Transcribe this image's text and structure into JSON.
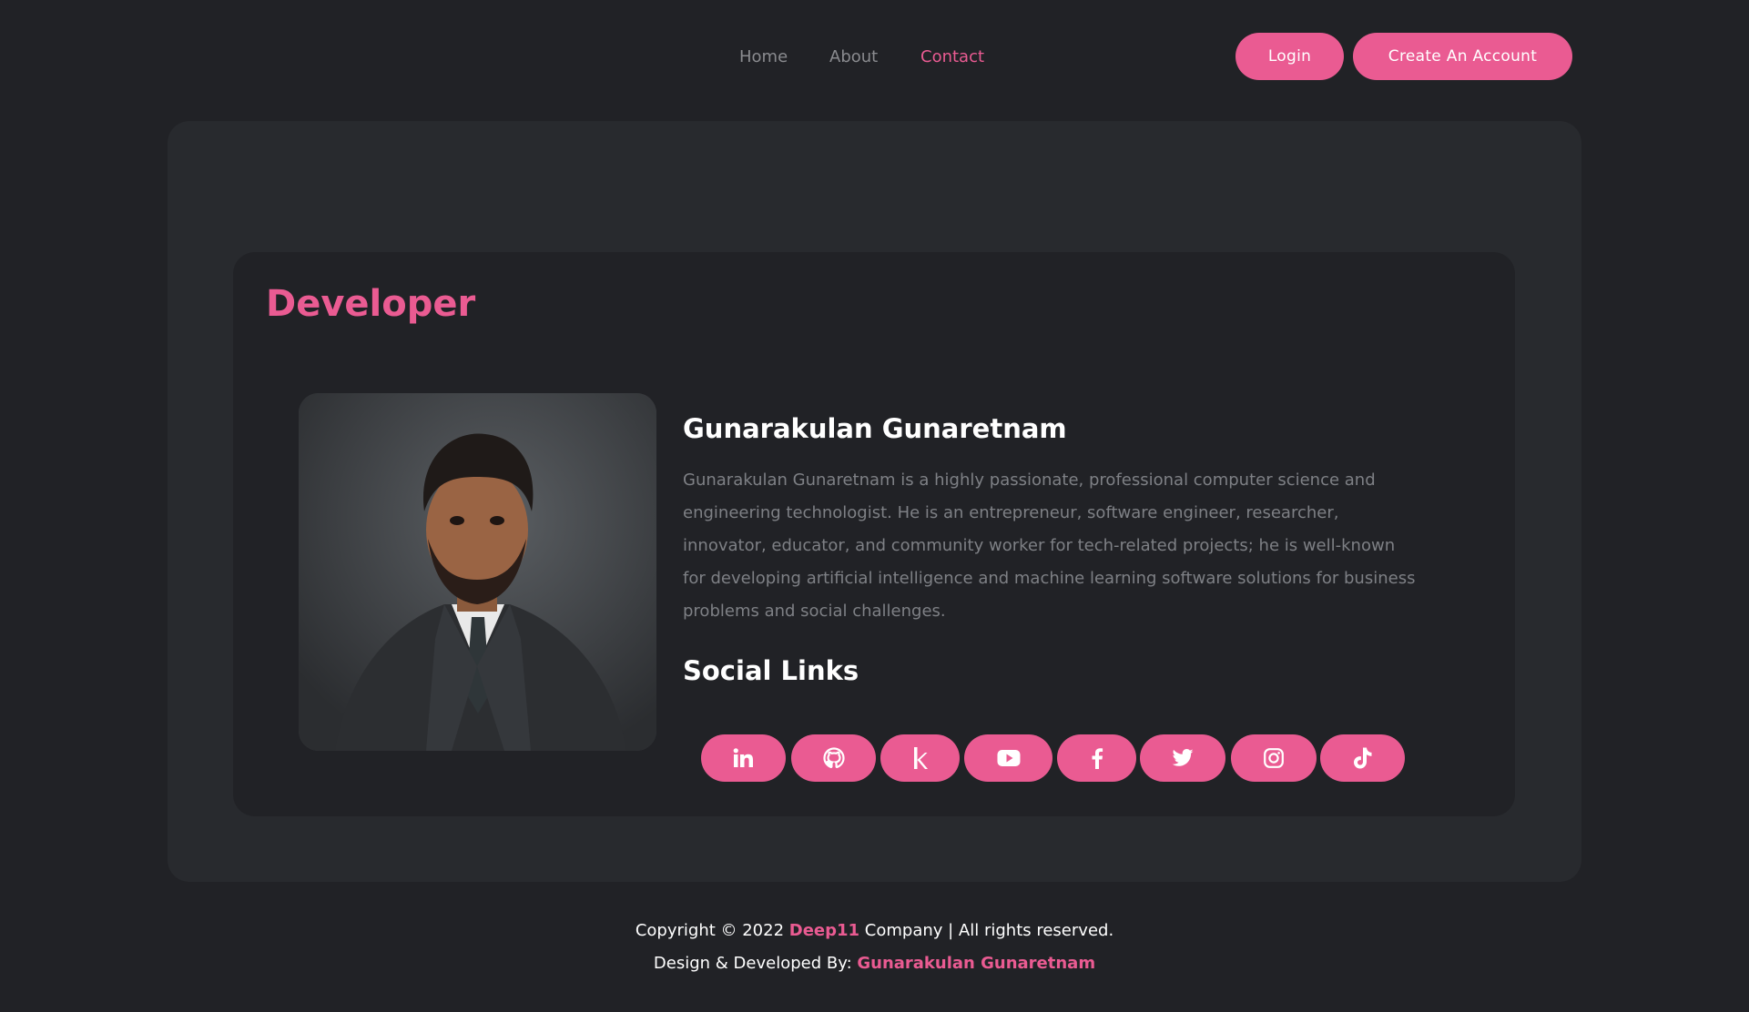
{
  "nav": {
    "items": [
      {
        "label": "Home",
        "active": false
      },
      {
        "label": "About",
        "active": false
      },
      {
        "label": "Contact",
        "active": true
      }
    ],
    "login_label": "Login",
    "create_account_label": "Create An Account"
  },
  "section": {
    "title": "Developer"
  },
  "developer": {
    "name": "Gunarakulan Gunaretnam",
    "bio": "Gunarakulan Gunaretnam is a highly passionate, professional computer science and engineering technologist. He is an entrepreneur, software engineer, researcher, innovator, educator, and community worker for tech-related projects; he is well-known for developing artificial intelligence and machine learning software solutions for business problems and social challenges."
  },
  "social": {
    "title": "Social Links",
    "links": [
      {
        "icon": "linkedin-icon"
      },
      {
        "icon": "github-icon"
      },
      {
        "icon": "kaggle-icon"
      },
      {
        "icon": "youtube-icon"
      },
      {
        "icon": "facebook-icon"
      },
      {
        "icon": "twitter-icon"
      },
      {
        "icon": "instagram-icon"
      },
      {
        "icon": "tiktok-icon"
      }
    ]
  },
  "footer": {
    "copyright_prefix": "Copyright © 2022 ",
    "company_name": "Deep11",
    "copyright_suffix": " Company | All rights reserved.",
    "credit_prefix": "Design & Developed By: ",
    "credit_name": "Gunarakulan Gunaretnam"
  },
  "colors": {
    "accent": "#ea5b92",
    "background": "#212226",
    "panel": "#282a2e"
  }
}
